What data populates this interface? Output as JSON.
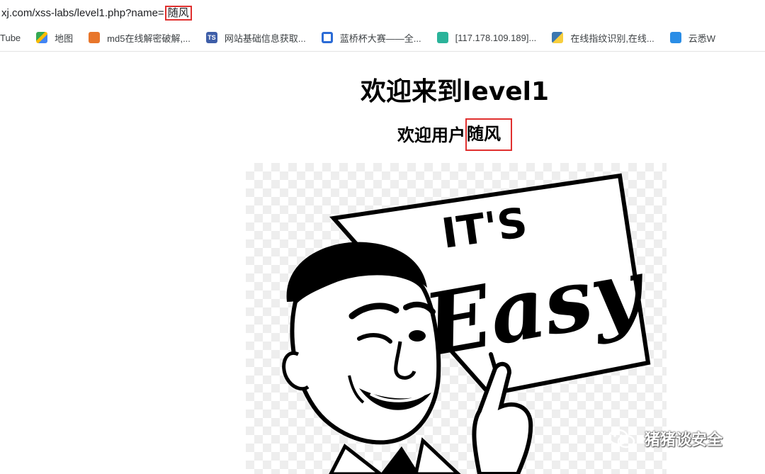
{
  "address_bar": {
    "url_prefix": "xj.com/xss-labs/level1.php?name=",
    "url_param": "随风"
  },
  "bookmarks": [
    {
      "label": "Tube",
      "icon": "none"
    },
    {
      "label": "地图",
      "icon": "maps-icon"
    },
    {
      "label": "md5在线解密破解,...",
      "icon": "md5-icon"
    },
    {
      "label": "网站基础信息获取...",
      "icon": "ts-icon"
    },
    {
      "label": "蓝桥杯大赛——全...",
      "icon": "lanqiao-icon"
    },
    {
      "label": "[117.178.109.189]...",
      "icon": "gear-icon"
    },
    {
      "label": "在线指纹识别,在线...",
      "icon": "python-icon"
    },
    {
      "label": "云悉W",
      "icon": "yunxi-icon"
    }
  ],
  "page": {
    "title": "欢迎来到level1",
    "welcome_prefix": "欢迎用户",
    "username": "随风"
  },
  "image": {
    "sign_line1": "IT'S",
    "sign_line2": "Easy"
  },
  "watermark": {
    "text": "猪猪谈安全"
  },
  "colors": {
    "highlight": "#e0302f"
  }
}
